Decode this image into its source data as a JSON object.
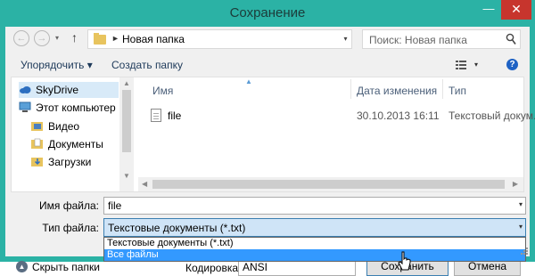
{
  "window": {
    "title": "Сохранение",
    "min_glyph": "—",
    "close_glyph": "✕"
  },
  "nav": {
    "back_glyph": "←",
    "forward_glyph": "→",
    "recent_glyph": "▾",
    "up_glyph": "↑",
    "path_separator": "►",
    "path": "Новая папка",
    "address_dropdown_glyph": "▾",
    "refresh_glyph": "↻",
    "search_placeholder": "Поиск: Новая папка"
  },
  "toolbar": {
    "organize_label": "Упорядочить ▾",
    "new_folder_label": "Создать папку",
    "view_dropdown_glyph": "▾",
    "help_glyph": "?"
  },
  "sidebar": {
    "items": [
      {
        "label": "SkyDrive",
        "icon": "cloud-icon",
        "selected": true
      },
      {
        "label": "Этот компьютер",
        "icon": "computer-icon"
      },
      {
        "label": "Видео",
        "icon": "video-folder-icon"
      },
      {
        "label": "Документы",
        "icon": "documents-folder-icon"
      },
      {
        "label": "Загрузки",
        "icon": "downloads-folder-icon"
      }
    ]
  },
  "files": {
    "columns": {
      "name": "Имя",
      "date": "Дата изменения",
      "type": "Тип"
    },
    "rows": [
      {
        "name": "file",
        "date": "30.10.2013 16:11",
        "type": "Текстовый докум..."
      }
    ]
  },
  "form": {
    "filename_label": "Имя файла:",
    "filename_value": "file",
    "filetype_label": "Тип файла:",
    "filetype_value": "Текстовые документы (*.txt)",
    "filetype_options": [
      "Текстовые документы (*.txt)",
      "Все файлы"
    ],
    "filetype_highlighted": "Все файлы",
    "encoding_label": "Кодировка:",
    "encoding_value": "ANSI",
    "hide_folders_label": "Скрыть папки",
    "hide_folders_glyph": "▲",
    "save_label": "Сохранить",
    "cancel_label": "Отмена"
  },
  "colors": {
    "titlebar": "#2bb2a5",
    "close_button": "#c7352d",
    "selection": "#3399ff",
    "nav_selected": "#d8eaf8"
  }
}
